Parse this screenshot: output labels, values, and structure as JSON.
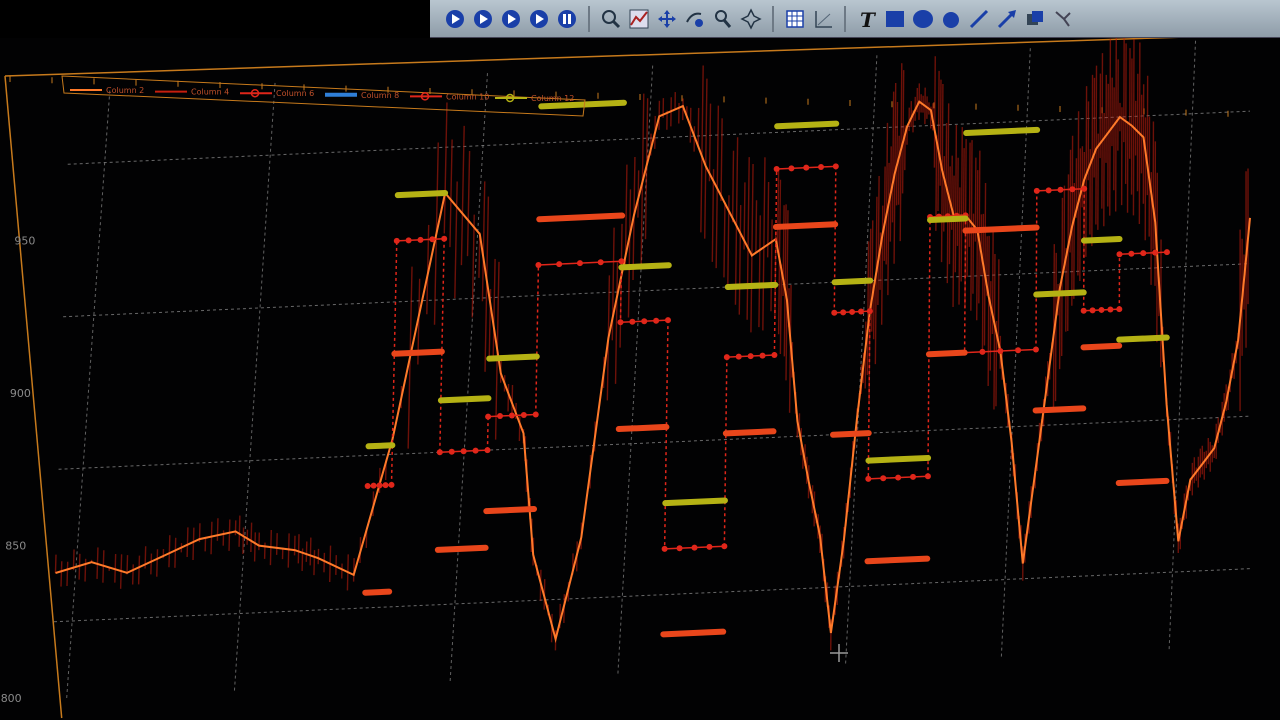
{
  "toolbar": {
    "icons": [
      "play-circle-icon",
      "play-circle-icon",
      "play-circle-icon",
      "play-circle-icon",
      "pause-circle-icon",
      "zoom-icon",
      "plot-icon",
      "move-icon",
      "zoom-in-icon",
      "pick-icon",
      "pan-icon",
      "grid-icon",
      "axis-icon",
      "text-tool-icon",
      "rectangle-tool-icon",
      "ellipse-tool-icon",
      "circle-tool-icon",
      "line-tool-icon",
      "arrow-tool-icon",
      "copy-icon",
      "select-icon"
    ],
    "text_tool_label": "T"
  },
  "colors": {
    "background": "#020203",
    "frame": "#c77a1c",
    "grid": "#8b8b8b",
    "column2": "#ff7a2a",
    "column4": "#c61e0e",
    "column6": "#e0261a",
    "column8": "#e9461b",
    "column10": "#b5b214",
    "cursor": "#9a9a9a"
  },
  "chart_data": {
    "type": "line",
    "legend": [
      "Column 2",
      "Column 4",
      "Column 6",
      "Column 8",
      "Column 10",
      "Column 12"
    ],
    "legend_position": "top-left",
    "grid": true,
    "y_ticks": [
      "800",
      "850",
      "900",
      "950"
    ],
    "ylim": [
      800,
      1000
    ],
    "xlim": [
      0,
      100
    ],
    "series": [
      {
        "name": "Column 2",
        "style": "line",
        "x": [
          0,
          3,
          6,
          9,
          12,
          15,
          17,
          20,
          22,
          25,
          28,
          32,
          35,
          37,
          39,
          40,
          42,
          44,
          46,
          48,
          50,
          52,
          54,
          56,
          58,
          60,
          61,
          62,
          63,
          64,
          65,
          66,
          67,
          68,
          69,
          70,
          71,
          72,
          73,
          74,
          75,
          76,
          77,
          78,
          79,
          80,
          81,
          82,
          83,
          84,
          85,
          86,
          87,
          88,
          89,
          90,
          91,
          92,
          93,
          94,
          95,
          96,
          97,
          98,
          99,
          100
        ],
        "y": [
          841,
          844,
          840,
          845,
          850,
          852,
          847,
          845,
          842,
          836,
          880,
          960,
          946,
          900,
          880,
          840,
          812,
          845,
          910,
          950,
          982,
          985,
          965,
          950,
          935,
          940,
          920,
          880,
          860,
          842,
          810,
          840,
          880,
          915,
          940,
          960,
          975,
          983,
          980,
          960,
          945,
          945,
          940,
          918,
          900,
          870,
          830,
          860,
          890,
          920,
          940,
          955,
          965,
          970,
          975,
          972,
          968,
          940,
          880,
          835,
          855,
          860,
          865,
          880,
          900,
          940
        ]
      },
      {
        "name": "Column 4",
        "style": "noisy",
        "x": [],
        "y": []
      },
      {
        "name": "Column 6",
        "style": "step-dots",
        "x": [
          26,
          28,
          28,
          32,
          32,
          36,
          36,
          40,
          40,
          47,
          47,
          51,
          51,
          56,
          56,
          60,
          60,
          65,
          65,
          68,
          68,
          73,
          73,
          76,
          76,
          82,
          82,
          86,
          86,
          89,
          89,
          93
        ],
        "y": [
          865,
          865,
          945,
          945,
          875,
          875,
          886,
          886,
          935,
          935,
          915,
          915,
          840,
          840,
          902,
          902,
          963,
          963,
          915,
          915,
          860,
          860,
          945,
          945,
          900,
          900,
          952,
          952,
          912,
          912,
          930,
          930
        ]
      },
      {
        "name": "Column 8",
        "style": "step-bars",
        "x": [
          26,
          28,
          28,
          32,
          32,
          36,
          36,
          40,
          40,
          47,
          47,
          51,
          51,
          56,
          56,
          60,
          60,
          65,
          65,
          68,
          68,
          73,
          73,
          76,
          76,
          82,
          82,
          86,
          86,
          89,
          89,
          93
        ],
        "y": [
          830,
          830,
          908,
          908,
          843,
          843,
          855,
          855,
          950,
          950,
          880,
          880,
          812,
          812,
          877,
          877,
          944,
          944,
          875,
          875,
          833,
          833,
          900,
          900,
          940,
          940,
          880,
          880,
          900,
          900,
          855,
          855
        ]
      },
      {
        "name": "Column 10",
        "style": "step-bars",
        "x": [
          26,
          28,
          28,
          32,
          32,
          36,
          36,
          40,
          40,
          47,
          47,
          51,
          51,
          56,
          56,
          60,
          60,
          65,
          65,
          68,
          68,
          73,
          73,
          76,
          76,
          82,
          82,
          86,
          86,
          89,
          89,
          93
        ],
        "y": [
          878,
          878,
          960,
          960,
          892,
          892,
          905,
          905,
          987,
          987,
          933,
          933,
          855,
          855,
          925,
          925,
          977,
          977,
          925,
          925,
          866,
          866,
          944,
          944,
          972,
          972,
          918,
          918,
          935,
          935,
          902,
          902
        ]
      }
    ]
  }
}
